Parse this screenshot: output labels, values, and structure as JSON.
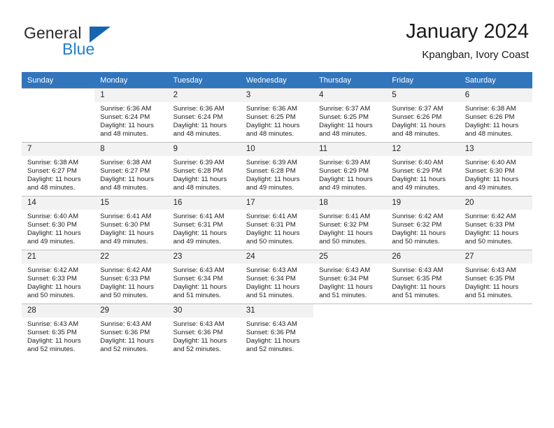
{
  "brand": {
    "name_part1": "General",
    "name_part2": "Blue",
    "triangle_icon": "brand-triangle-icon",
    "colors": {
      "general": "#2b2b2b",
      "blue": "#1f7fd0",
      "triangle": "#1565b0"
    }
  },
  "header": {
    "title": "January 2024",
    "subtitle": "Kpangban, Ivory Coast"
  },
  "colors": {
    "header_row_bg": "#3176bc",
    "header_row_text": "#ffffff",
    "daynum_bg": "#f2f2f2",
    "grid_line": "#bfbfbf",
    "cell_bg": "#ffffff"
  },
  "weekday_headers": [
    "Sunday",
    "Monday",
    "Tuesday",
    "Wednesday",
    "Thursday",
    "Friday",
    "Saturday"
  ],
  "weeks": [
    {
      "days": [
        {
          "num": "",
          "sunrise": "",
          "sunset": "",
          "daylight_line1": "",
          "daylight_line2": "",
          "empty": true
        },
        {
          "num": "1",
          "sunrise": "Sunrise: 6:36 AM",
          "sunset": "Sunset: 6:24 PM",
          "daylight_line1": "Daylight: 11 hours",
          "daylight_line2": "and 48 minutes.",
          "empty": false
        },
        {
          "num": "2",
          "sunrise": "Sunrise: 6:36 AM",
          "sunset": "Sunset: 6:24 PM",
          "daylight_line1": "Daylight: 11 hours",
          "daylight_line2": "and 48 minutes.",
          "empty": false
        },
        {
          "num": "3",
          "sunrise": "Sunrise: 6:36 AM",
          "sunset": "Sunset: 6:25 PM",
          "daylight_line1": "Daylight: 11 hours",
          "daylight_line2": "and 48 minutes.",
          "empty": false
        },
        {
          "num": "4",
          "sunrise": "Sunrise: 6:37 AM",
          "sunset": "Sunset: 6:25 PM",
          "daylight_line1": "Daylight: 11 hours",
          "daylight_line2": "and 48 minutes.",
          "empty": false
        },
        {
          "num": "5",
          "sunrise": "Sunrise: 6:37 AM",
          "sunset": "Sunset: 6:26 PM",
          "daylight_line1": "Daylight: 11 hours",
          "daylight_line2": "and 48 minutes.",
          "empty": false
        },
        {
          "num": "6",
          "sunrise": "Sunrise: 6:38 AM",
          "sunset": "Sunset: 6:26 PM",
          "daylight_line1": "Daylight: 11 hours",
          "daylight_line2": "and 48 minutes.",
          "empty": false
        }
      ]
    },
    {
      "days": [
        {
          "num": "7",
          "sunrise": "Sunrise: 6:38 AM",
          "sunset": "Sunset: 6:27 PM",
          "daylight_line1": "Daylight: 11 hours",
          "daylight_line2": "and 48 minutes.",
          "empty": false
        },
        {
          "num": "8",
          "sunrise": "Sunrise: 6:38 AM",
          "sunset": "Sunset: 6:27 PM",
          "daylight_line1": "Daylight: 11 hours",
          "daylight_line2": "and 48 minutes.",
          "empty": false
        },
        {
          "num": "9",
          "sunrise": "Sunrise: 6:39 AM",
          "sunset": "Sunset: 6:28 PM",
          "daylight_line1": "Daylight: 11 hours",
          "daylight_line2": "and 48 minutes.",
          "empty": false
        },
        {
          "num": "10",
          "sunrise": "Sunrise: 6:39 AM",
          "sunset": "Sunset: 6:28 PM",
          "daylight_line1": "Daylight: 11 hours",
          "daylight_line2": "and 49 minutes.",
          "empty": false
        },
        {
          "num": "11",
          "sunrise": "Sunrise: 6:39 AM",
          "sunset": "Sunset: 6:29 PM",
          "daylight_line1": "Daylight: 11 hours",
          "daylight_line2": "and 49 minutes.",
          "empty": false
        },
        {
          "num": "12",
          "sunrise": "Sunrise: 6:40 AM",
          "sunset": "Sunset: 6:29 PM",
          "daylight_line1": "Daylight: 11 hours",
          "daylight_line2": "and 49 minutes.",
          "empty": false
        },
        {
          "num": "13",
          "sunrise": "Sunrise: 6:40 AM",
          "sunset": "Sunset: 6:30 PM",
          "daylight_line1": "Daylight: 11 hours",
          "daylight_line2": "and 49 minutes.",
          "empty": false
        }
      ]
    },
    {
      "days": [
        {
          "num": "14",
          "sunrise": "Sunrise: 6:40 AM",
          "sunset": "Sunset: 6:30 PM",
          "daylight_line1": "Daylight: 11 hours",
          "daylight_line2": "and 49 minutes.",
          "empty": false
        },
        {
          "num": "15",
          "sunrise": "Sunrise: 6:41 AM",
          "sunset": "Sunset: 6:30 PM",
          "daylight_line1": "Daylight: 11 hours",
          "daylight_line2": "and 49 minutes.",
          "empty": false
        },
        {
          "num": "16",
          "sunrise": "Sunrise: 6:41 AM",
          "sunset": "Sunset: 6:31 PM",
          "daylight_line1": "Daylight: 11 hours",
          "daylight_line2": "and 49 minutes.",
          "empty": false
        },
        {
          "num": "17",
          "sunrise": "Sunrise: 6:41 AM",
          "sunset": "Sunset: 6:31 PM",
          "daylight_line1": "Daylight: 11 hours",
          "daylight_line2": "and 50 minutes.",
          "empty": false
        },
        {
          "num": "18",
          "sunrise": "Sunrise: 6:41 AM",
          "sunset": "Sunset: 6:32 PM",
          "daylight_line1": "Daylight: 11 hours",
          "daylight_line2": "and 50 minutes.",
          "empty": false
        },
        {
          "num": "19",
          "sunrise": "Sunrise: 6:42 AM",
          "sunset": "Sunset: 6:32 PM",
          "daylight_line1": "Daylight: 11 hours",
          "daylight_line2": "and 50 minutes.",
          "empty": false
        },
        {
          "num": "20",
          "sunrise": "Sunrise: 6:42 AM",
          "sunset": "Sunset: 6:33 PM",
          "daylight_line1": "Daylight: 11 hours",
          "daylight_line2": "and 50 minutes.",
          "empty": false
        }
      ]
    },
    {
      "days": [
        {
          "num": "21",
          "sunrise": "Sunrise: 6:42 AM",
          "sunset": "Sunset: 6:33 PM",
          "daylight_line1": "Daylight: 11 hours",
          "daylight_line2": "and 50 minutes.",
          "empty": false
        },
        {
          "num": "22",
          "sunrise": "Sunrise: 6:42 AM",
          "sunset": "Sunset: 6:33 PM",
          "daylight_line1": "Daylight: 11 hours",
          "daylight_line2": "and 50 minutes.",
          "empty": false
        },
        {
          "num": "23",
          "sunrise": "Sunrise: 6:43 AM",
          "sunset": "Sunset: 6:34 PM",
          "daylight_line1": "Daylight: 11 hours",
          "daylight_line2": "and 51 minutes.",
          "empty": false
        },
        {
          "num": "24",
          "sunrise": "Sunrise: 6:43 AM",
          "sunset": "Sunset: 6:34 PM",
          "daylight_line1": "Daylight: 11 hours",
          "daylight_line2": "and 51 minutes.",
          "empty": false
        },
        {
          "num": "25",
          "sunrise": "Sunrise: 6:43 AM",
          "sunset": "Sunset: 6:34 PM",
          "daylight_line1": "Daylight: 11 hours",
          "daylight_line2": "and 51 minutes.",
          "empty": false
        },
        {
          "num": "26",
          "sunrise": "Sunrise: 6:43 AM",
          "sunset": "Sunset: 6:35 PM",
          "daylight_line1": "Daylight: 11 hours",
          "daylight_line2": "and 51 minutes.",
          "empty": false
        },
        {
          "num": "27",
          "sunrise": "Sunrise: 6:43 AM",
          "sunset": "Sunset: 6:35 PM",
          "daylight_line1": "Daylight: 11 hours",
          "daylight_line2": "and 51 minutes.",
          "empty": false
        }
      ]
    },
    {
      "days": [
        {
          "num": "28",
          "sunrise": "Sunrise: 6:43 AM",
          "sunset": "Sunset: 6:35 PM",
          "daylight_line1": "Daylight: 11 hours",
          "daylight_line2": "and 52 minutes.",
          "empty": false
        },
        {
          "num": "29",
          "sunrise": "Sunrise: 6:43 AM",
          "sunset": "Sunset: 6:36 PM",
          "daylight_line1": "Daylight: 11 hours",
          "daylight_line2": "and 52 minutes.",
          "empty": false
        },
        {
          "num": "30",
          "sunrise": "Sunrise: 6:43 AM",
          "sunset": "Sunset: 6:36 PM",
          "daylight_line1": "Daylight: 11 hours",
          "daylight_line2": "and 52 minutes.",
          "empty": false
        },
        {
          "num": "31",
          "sunrise": "Sunrise: 6:43 AM",
          "sunset": "Sunset: 6:36 PM",
          "daylight_line1": "Daylight: 11 hours",
          "daylight_line2": "and 52 minutes.",
          "empty": false
        },
        {
          "num": "",
          "sunrise": "",
          "sunset": "",
          "daylight_line1": "",
          "daylight_line2": "",
          "empty": true
        },
        {
          "num": "",
          "sunrise": "",
          "sunset": "",
          "daylight_line1": "",
          "daylight_line2": "",
          "empty": true
        },
        {
          "num": "",
          "sunrise": "",
          "sunset": "",
          "daylight_line1": "",
          "daylight_line2": "",
          "empty": true
        }
      ]
    }
  ]
}
